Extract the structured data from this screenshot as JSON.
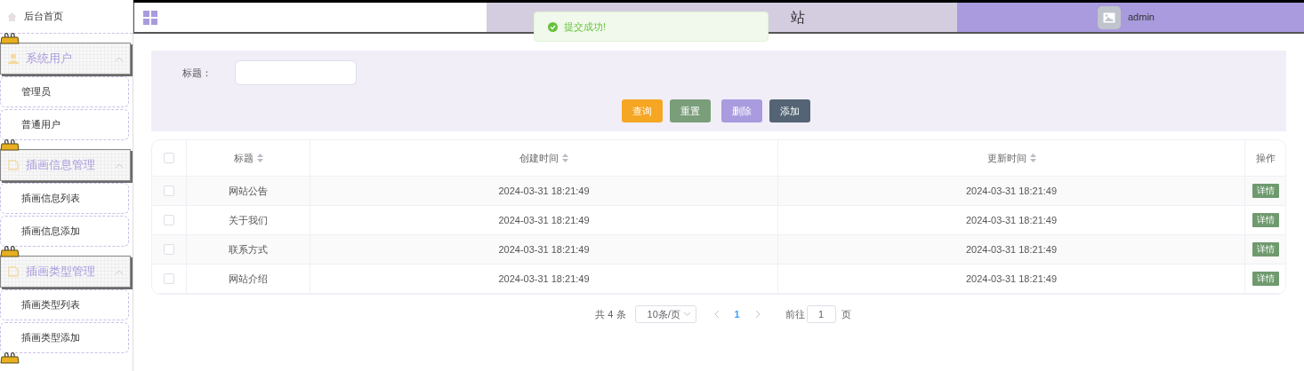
{
  "sidebar": {
    "home": "后台首页",
    "groups": [
      {
        "title": "系统用户",
        "kind": "user",
        "expanded": true,
        "items": [
          "管理员",
          "普通用户"
        ]
      },
      {
        "title": "插画信息管理",
        "kind": "doc",
        "expanded": true,
        "items": [
          "插画信息列表",
          "插画信息添加"
        ]
      },
      {
        "title": "插画类型管理",
        "kind": "doc",
        "expanded": true,
        "items": [
          "插画类型列表",
          "插画类型添加"
        ]
      }
    ]
  },
  "header": {
    "title_fragment": "站",
    "user": "admin"
  },
  "toast": {
    "message": "提交成功!"
  },
  "filter": {
    "label": "标题：",
    "buttons": [
      {
        "label": "查询",
        "color": "#f5a623"
      },
      {
        "label": "重置",
        "color": "#7a9e7a"
      },
      {
        "label": "删除",
        "color": "#a99bde"
      },
      {
        "label": "添加",
        "color": "#546474"
      }
    ]
  },
  "table": {
    "select_all_checked": false,
    "columns": [
      {
        "label": "标题",
        "sortable": true
      },
      {
        "label": "创建时间",
        "sortable": true
      },
      {
        "label": "更新时间",
        "sortable": true
      },
      {
        "label": "操作",
        "sortable": false
      }
    ],
    "rows": [
      {
        "checked": false,
        "cells": [
          "网站公告",
          "2024-03-31 18:21:49",
          "2024-03-31 18:21:49"
        ],
        "action": "详情"
      },
      {
        "checked": false,
        "cells": [
          "关于我们",
          "2024-03-31 18:21:49",
          "2024-03-31 18:21:49"
        ],
        "action": "详情"
      },
      {
        "checked": false,
        "cells": [
          "联系方式",
          "2024-03-31 18:21:49",
          "2024-03-31 18:21:49"
        ],
        "action": "详情"
      },
      {
        "checked": false,
        "cells": [
          "网站介绍",
          "2024-03-31 18:21:49",
          "2024-03-31 18:21:49"
        ],
        "action": "详情"
      }
    ]
  },
  "pagination": {
    "total": "共 4 条",
    "page_size": "10条/页",
    "pages": [
      {
        "label": "1",
        "selected": true
      }
    ],
    "goto_label": "前往",
    "goto_value": "1",
    "goto_suffix": "页"
  }
}
